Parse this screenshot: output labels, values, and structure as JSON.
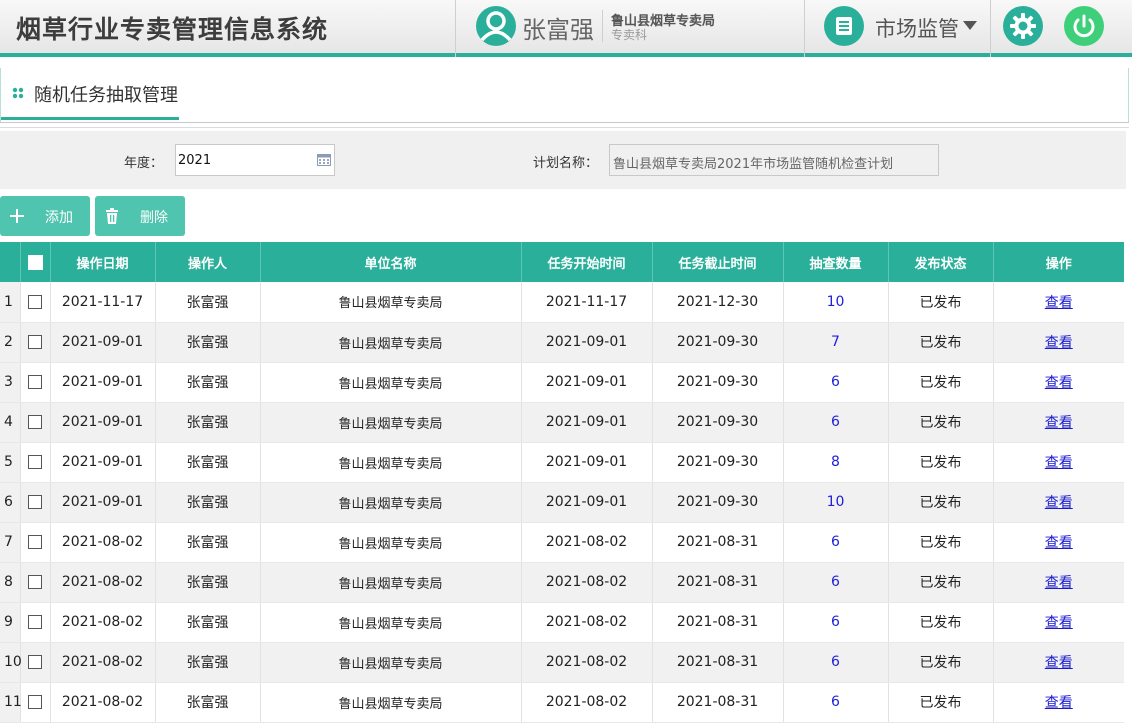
{
  "header": {
    "app_title": "烟草行业专卖管理信息系统",
    "user_name": "张富强",
    "org_name": "鲁山县烟草专卖局",
    "org_dept": "专卖科",
    "module_name": "市场监管",
    "accent_color": "#2ab09a"
  },
  "page": {
    "title": "随机任务抽取管理"
  },
  "filter": {
    "year_label": "年度：",
    "year_value": "2021",
    "plan_label": "计划名称：",
    "plan_value": "鲁山县烟草专卖局2021年市场监管随机检查计划"
  },
  "toolbar": {
    "add_label": "添加",
    "delete_label": "删除"
  },
  "table": {
    "columns": [
      "操作日期",
      "操作人",
      "单位名称",
      "任务开始时间",
      "任务截止时间",
      "抽查数量",
      "发布状态",
      "操作"
    ],
    "view_label": "查看",
    "rows": [
      {
        "num": "1",
        "date": "2021-11-17",
        "operator": "张富强",
        "unit": "鲁山县烟草专卖局",
        "start": "2021-11-17",
        "end": "2021-12-30",
        "qty": "10",
        "status": "已发布"
      },
      {
        "num": "2",
        "date": "2021-09-01",
        "operator": "张富强",
        "unit": "鲁山县烟草专卖局",
        "start": "2021-09-01",
        "end": "2021-09-30",
        "qty": "7",
        "status": "已发布"
      },
      {
        "num": "3",
        "date": "2021-09-01",
        "operator": "张富强",
        "unit": "鲁山县烟草专卖局",
        "start": "2021-09-01",
        "end": "2021-09-30",
        "qty": "6",
        "status": "已发布"
      },
      {
        "num": "4",
        "date": "2021-09-01",
        "operator": "张富强",
        "unit": "鲁山县烟草专卖局",
        "start": "2021-09-01",
        "end": "2021-09-30",
        "qty": "6",
        "status": "已发布"
      },
      {
        "num": "5",
        "date": "2021-09-01",
        "operator": "张富强",
        "unit": "鲁山县烟草专卖局",
        "start": "2021-09-01",
        "end": "2021-09-30",
        "qty": "8",
        "status": "已发布"
      },
      {
        "num": "6",
        "date": "2021-09-01",
        "operator": "张富强",
        "unit": "鲁山县烟草专卖局",
        "start": "2021-09-01",
        "end": "2021-09-30",
        "qty": "10",
        "status": "已发布"
      },
      {
        "num": "7",
        "date": "2021-08-02",
        "operator": "张富强",
        "unit": "鲁山县烟草专卖局",
        "start": "2021-08-02",
        "end": "2021-08-31",
        "qty": "6",
        "status": "已发布"
      },
      {
        "num": "8",
        "date": "2021-08-02",
        "operator": "张富强",
        "unit": "鲁山县烟草专卖局",
        "start": "2021-08-02",
        "end": "2021-08-31",
        "qty": "6",
        "status": "已发布"
      },
      {
        "num": "9",
        "date": "2021-08-02",
        "operator": "张富强",
        "unit": "鲁山县烟草专卖局",
        "start": "2021-08-02",
        "end": "2021-08-31",
        "qty": "6",
        "status": "已发布"
      },
      {
        "num": "10",
        "date": "2021-08-02",
        "operator": "张富强",
        "unit": "鲁山县烟草专卖局",
        "start": "2021-08-02",
        "end": "2021-08-31",
        "qty": "6",
        "status": "已发布"
      },
      {
        "num": "11",
        "date": "2021-08-02",
        "operator": "张富强",
        "unit": "鲁山县烟草专卖局",
        "start": "2021-08-02",
        "end": "2021-08-31",
        "qty": "6",
        "status": "已发布"
      }
    ]
  }
}
